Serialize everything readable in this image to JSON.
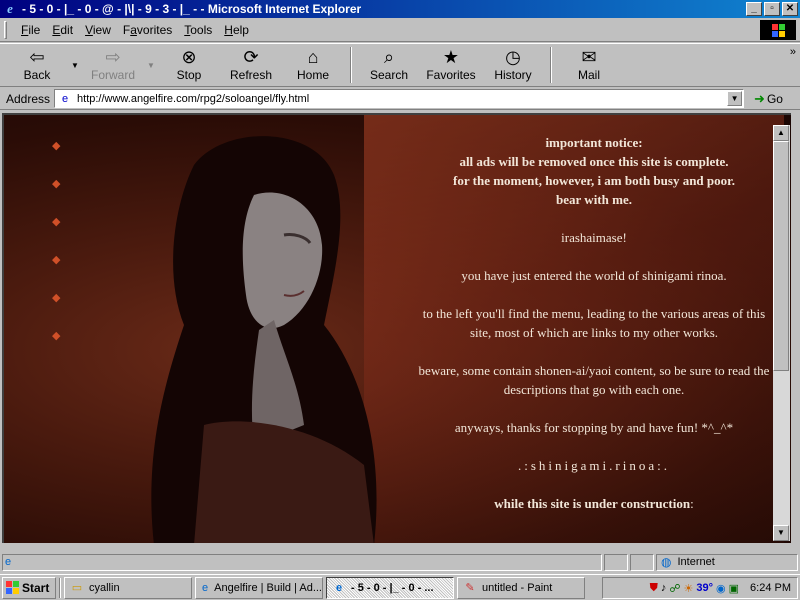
{
  "window": {
    "title": "- 5 - 0 - |_ - 0 - @ - |\\| - 9 - 3 - |_ - - Microsoft Internet Explorer"
  },
  "menu": [
    {
      "label": "File",
      "key": "F",
      "rest": "ile"
    },
    {
      "label": "Edit",
      "key": "E",
      "rest": "dit"
    },
    {
      "label": "View",
      "key": "V",
      "rest": "iew"
    },
    {
      "label": "Favorites",
      "key": "a",
      "pre": "F",
      "rest": "vorites"
    },
    {
      "label": "Tools",
      "key": "T",
      "rest": "ools"
    },
    {
      "label": "Help",
      "key": "H",
      "rest": "elp"
    }
  ],
  "toolbar": {
    "back": "Back",
    "forward": "Forward",
    "stop": "Stop",
    "refresh": "Refresh",
    "home": "Home",
    "search": "Search",
    "favorites": "Favorites",
    "history": "History",
    "mail": "Mail"
  },
  "address": {
    "label": "Address",
    "url": "http://www.angelfire.com/rpg2/soloangel/fly.html",
    "go": "Go"
  },
  "page": {
    "notice_lines": [
      "important notice:",
      "all ads will be removed once this site is complete.",
      "for the moment, however, i am both busy and poor.",
      "bear with me."
    ],
    "greeting": "irashaimase!",
    "entered": "you have just entered the world of shinigami rinoa.",
    "menu_info": "to the left you'll find the menu, leading to the various areas of this site, most of which are links to my other works.",
    "beware": "beware, some contain shonen-ai/yaoi content, so be sure to read the descriptions that go with each one.",
    "thanks": "anyways, thanks for stopping by and have fun! *^_^*",
    "signature": ".:shinigami.rinoa:.",
    "construction": "while this site is under construction",
    "construction_colon": ":"
  },
  "status": {
    "zone": "Internet"
  },
  "taskbar": {
    "start": "Start",
    "tasks": [
      {
        "label": "cyallin",
        "icon": "folder-icon"
      },
      {
        "label": "Angelfire | Build | Ad...",
        "icon": "ie-icon"
      },
      {
        "label": "- 5 - 0 - |_ - 0 - ...",
        "icon": "ie-icon",
        "active": true
      },
      {
        "label": "untitled - Paint",
        "icon": "paint-icon"
      }
    ],
    "temperature": "39°",
    "clock": "6:24 PM"
  },
  "colors": {
    "titlebar": "#000080",
    "bullet": "#d05028",
    "text": "#f2e6d8"
  }
}
